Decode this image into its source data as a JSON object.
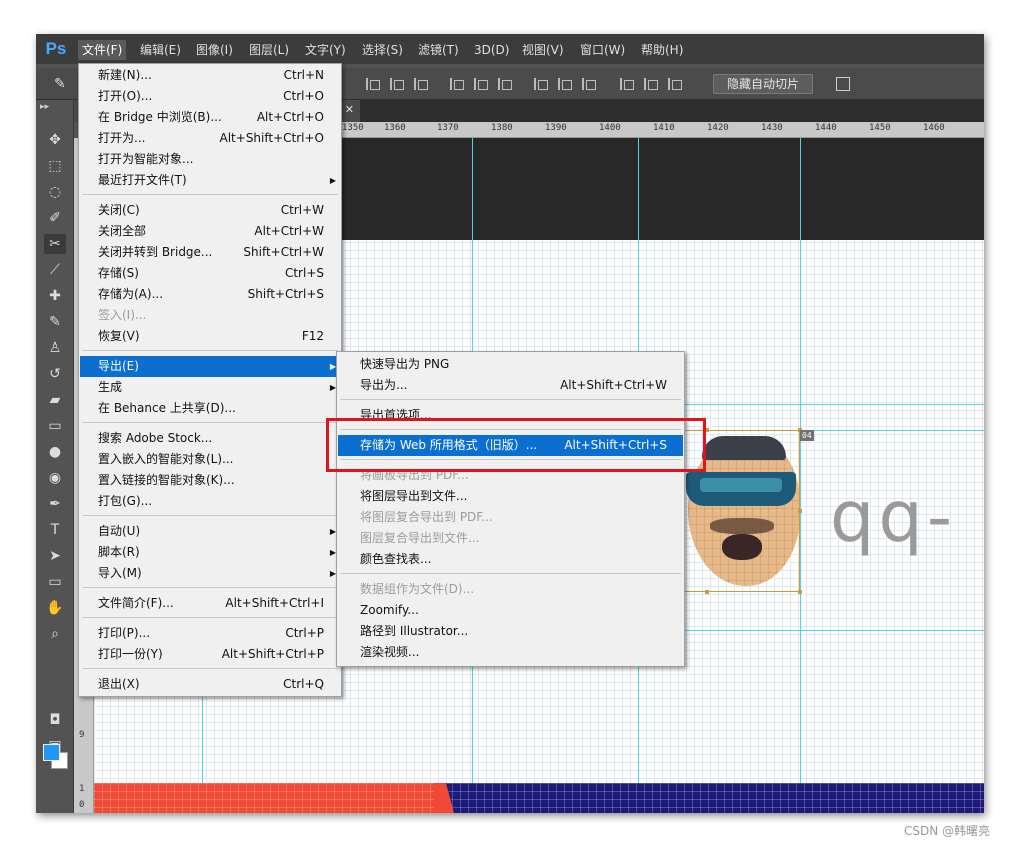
{
  "app": {
    "logo": "Ps"
  },
  "menubar": {
    "items": [
      {
        "label": "文件(F)",
        "active": true
      },
      {
        "label": "编辑(E)"
      },
      {
        "label": "图像(I)"
      },
      {
        "label": "图层(L)"
      },
      {
        "label": "文字(Y)"
      },
      {
        "label": "选择(S)"
      },
      {
        "label": "滤镜(T)"
      },
      {
        "label": "3D(D)"
      },
      {
        "label": "视图(V)"
      },
      {
        "label": "窗口(W)"
      },
      {
        "label": "帮助(H)"
      }
    ]
  },
  "options_bar": {
    "hide_auto_slices": "隐藏自动切片"
  },
  "rulers": {
    "top_labels": [
      "1350",
      "1360",
      "1370",
      "1380",
      "1390",
      "1400",
      "1410",
      "1420",
      "1430",
      "1440",
      "1450",
      "1460"
    ],
    "left_labels": [
      "9",
      "1",
      "0"
    ]
  },
  "canvas": {
    "text": "qq-",
    "slice_badge": "04"
  },
  "file_menu": {
    "items": [
      {
        "label": "新建(N)...",
        "shortcut": "Ctrl+N"
      },
      {
        "label": "打开(O)...",
        "shortcut": "Ctrl+O"
      },
      {
        "label": "在 Bridge 中浏览(B)...",
        "shortcut": "Alt+Ctrl+O"
      },
      {
        "label": "打开为...",
        "shortcut": "Alt+Shift+Ctrl+O"
      },
      {
        "label": "打开为智能对象..."
      },
      {
        "label": "最近打开文件(T)",
        "submenu": true
      },
      {
        "label": "关闭(C)",
        "shortcut": "Ctrl+W"
      },
      {
        "label": "关闭全部",
        "shortcut": "Alt+Ctrl+W"
      },
      {
        "label": "关闭并转到 Bridge...",
        "shortcut": "Shift+Ctrl+W"
      },
      {
        "label": "存储(S)",
        "shortcut": "Ctrl+S"
      },
      {
        "label": "存储为(A)...",
        "shortcut": "Shift+Ctrl+S"
      },
      {
        "label": "签入(I)...",
        "disabled": true
      },
      {
        "label": "恢复(V)",
        "shortcut": "F12"
      },
      {
        "label": "导出(E)",
        "submenu": true,
        "highlighted": true
      },
      {
        "label": "生成",
        "submenu": true
      },
      {
        "label": "在 Behance 上共享(D)..."
      },
      {
        "label": "搜索 Adobe Stock..."
      },
      {
        "label": "置入嵌入的智能对象(L)..."
      },
      {
        "label": "置入链接的智能对象(K)..."
      },
      {
        "label": "打包(G)..."
      },
      {
        "label": "自动(U)",
        "submenu": true
      },
      {
        "label": "脚本(R)",
        "submenu": true
      },
      {
        "label": "导入(M)",
        "submenu": true
      },
      {
        "label": "文件简介(F)...",
        "shortcut": "Alt+Shift+Ctrl+I"
      },
      {
        "label": "打印(P)...",
        "shortcut": "Ctrl+P"
      },
      {
        "label": "打印一份(Y)",
        "shortcut": "Alt+Shift+Ctrl+P"
      },
      {
        "label": "退出(X)",
        "shortcut": "Ctrl+Q"
      }
    ]
  },
  "export_submenu": {
    "items": [
      {
        "label": "快速导出为 PNG"
      },
      {
        "label": "导出为...",
        "shortcut": "Alt+Shift+Ctrl+W"
      },
      {
        "label": "导出首选项..."
      },
      {
        "label": "存储为 Web 所用格式（旧版）...",
        "shortcut": "Alt+Shift+Ctrl+S",
        "highlighted": true
      },
      {
        "label": "将画板导出到 PDF...",
        "disabled": true
      },
      {
        "label": "将图层导出到文件..."
      },
      {
        "label": "将图层复合导出到 PDF...",
        "disabled": true
      },
      {
        "label": "图层复合导出到文件...",
        "disabled": true
      },
      {
        "label": "颜色查找表..."
      },
      {
        "label": "数据组作为文件(D)...",
        "disabled": true
      },
      {
        "label": "Zoomify..."
      },
      {
        "label": "路径到 Illustrator..."
      },
      {
        "label": "渲染视频..."
      }
    ]
  },
  "colors": {
    "menu_highlight": "#0a6fd0",
    "annotation_red": "#e0151b",
    "foreground": "#2196f3",
    "background": "#ffffff"
  },
  "watermark": "CSDN @韩曙亮"
}
